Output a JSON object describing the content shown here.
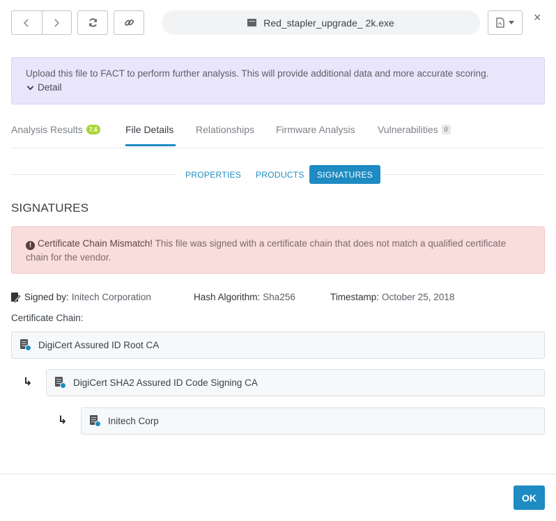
{
  "toolbar": {
    "back_icon": "chevron-left-icon",
    "forward_icon": "chevron-right-icon",
    "refresh_icon": "refresh-icon",
    "link_icon": "link-icon",
    "file_name": "Red_stapler_upgrade_ 2k.exe",
    "report_icon": "pdf-report-icon",
    "close_label": "×"
  },
  "info_banner": {
    "text": "Upload this file to FACT to perform further analysis. This will provide additional data and more accurate scoring.",
    "detail_label": "Detail"
  },
  "tabs": [
    {
      "label": "Analysis Results",
      "badge": "7.6"
    },
    {
      "label": "File Details",
      "active": true
    },
    {
      "label": "Relationships"
    },
    {
      "label": "Firmware Analysis"
    },
    {
      "label": "Vulnerabilities",
      "badge": "0"
    }
  ],
  "subtabs": [
    {
      "label": "PROPERTIES"
    },
    {
      "label": "PRODUCTS"
    },
    {
      "label": "SIGNATURES",
      "active": true
    }
  ],
  "section_title": "SIGNATURES",
  "warning": {
    "icon": "!",
    "title": "Certificate Chain Mismatch!",
    "text": " This file was signed with a certificate chain that does not match a qualified certificate chain for the vendor."
  },
  "meta": {
    "signed_by_label": "Signed by:",
    "signed_by_value": "Initech Corporation",
    "hash_label": "Hash Algorithm:",
    "hash_value": "Sha256",
    "timestamp_label": "Timestamp:",
    "timestamp_value": "October 25, 2018"
  },
  "chain_label": "Certificate Chain:",
  "chain": [
    {
      "name": "DigiCert Assured ID Root CA"
    },
    {
      "name": "DigiCert SHA2 Assured ID Code Signing CA"
    },
    {
      "name": "Initech Corp"
    }
  ],
  "arrow_glyph": "↳",
  "footer": {
    "ok_label": "OK"
  },
  "colors": {
    "accent": "#1e8bc3",
    "score_badge": "#a8d636",
    "warning_bg": "#f9dcdc",
    "info_bg": "#e9e6fb"
  }
}
